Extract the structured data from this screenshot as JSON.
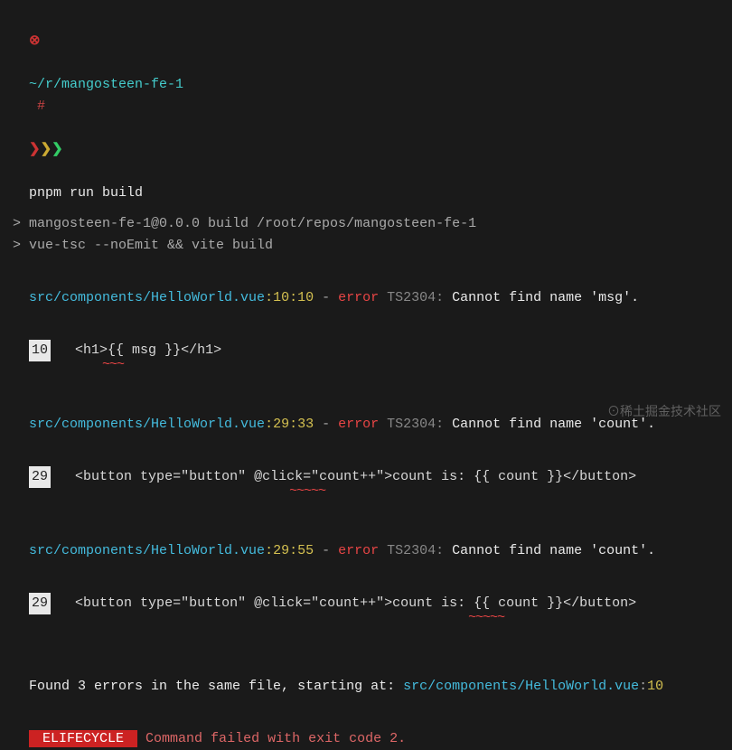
{
  "prompt": {
    "x": "⊗",
    "path": "~/r/mangosteen-fe-1",
    "hash": " #",
    "arrows": "❯❯❯",
    "command": "pnpm run build"
  },
  "build_header": {
    "line1": "> mangosteen-fe-1@0.0.0 build /root/repos/mangosteen-fe-1",
    "line2": "> vue-tsc --noEmit && vite build"
  },
  "errors": [
    {
      "file": "src/components/HelloWorld.vue",
      "pos": "10:10",
      "dash": " - ",
      "word": "error",
      "code": " TS2304: ",
      "msg": "Cannot find name 'msg'.",
      "ln": "10",
      "indent": "   ",
      "code_line": "<h1>{{ msg }}</h1>",
      "sq_pad": "           ",
      "squiggle": "~~~"
    },
    {
      "file": "src/components/HelloWorld.vue",
      "pos": "29:33",
      "dash": " - ",
      "word": "error",
      "code": " TS2304: ",
      "msg": "Cannot find name 'count'.",
      "ln": "29",
      "indent": "   ",
      "code_line": "<button type=\"button\" @click=\"count++\">count is: {{ count }}</button>",
      "sq_pad": "                                  ",
      "squiggle": "~~~~~"
    },
    {
      "file": "src/components/HelloWorld.vue",
      "pos": "29:55",
      "dash": " - ",
      "word": "error",
      "code": " TS2304: ",
      "msg": "Cannot find name 'count'.",
      "ln": "29",
      "indent": "   ",
      "code_line": "<button type=\"button\" @click=\"count++\">count is: {{ count }}</button>",
      "sq_pad": "                                                        ",
      "squiggle": "~~~~~"
    }
  ],
  "summary": {
    "prefix": "Found 3 errors in the same file, starting at: ",
    "file": "src/components/HelloWorld.vue",
    "colon": ":",
    "ln": "10"
  },
  "lifecycle": {
    "badge": " ELIFECYCLE ",
    "msg": " Command failed with exit code 2."
  },
  "watermark": "⊙稀土掘金技术社区"
}
